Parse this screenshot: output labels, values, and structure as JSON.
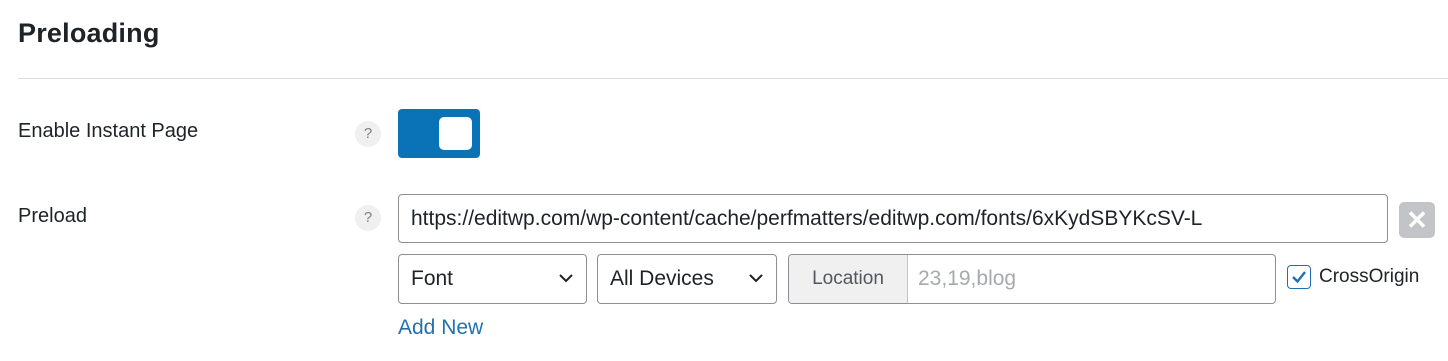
{
  "section": {
    "title": "Preloading"
  },
  "instant_page": {
    "label": "Enable Instant Page",
    "help": "?",
    "enabled": true
  },
  "preload": {
    "label": "Preload",
    "help": "?",
    "url": "https://editwp.com/wp-content/cache/perfmatters/editwp.com/fonts/6xKydSBYKcSV-L",
    "type": "Font",
    "device": "All Devices",
    "location_prefix": "Location",
    "location_placeholder": "23,19,blog",
    "crossorigin_label": "CrossOrigin",
    "crossorigin_checked": true,
    "add_new": "Add New"
  },
  "colors": {
    "toggle_on": "#0a73b8",
    "link": "#2271b1",
    "remove_button": "#c3c4c7"
  }
}
